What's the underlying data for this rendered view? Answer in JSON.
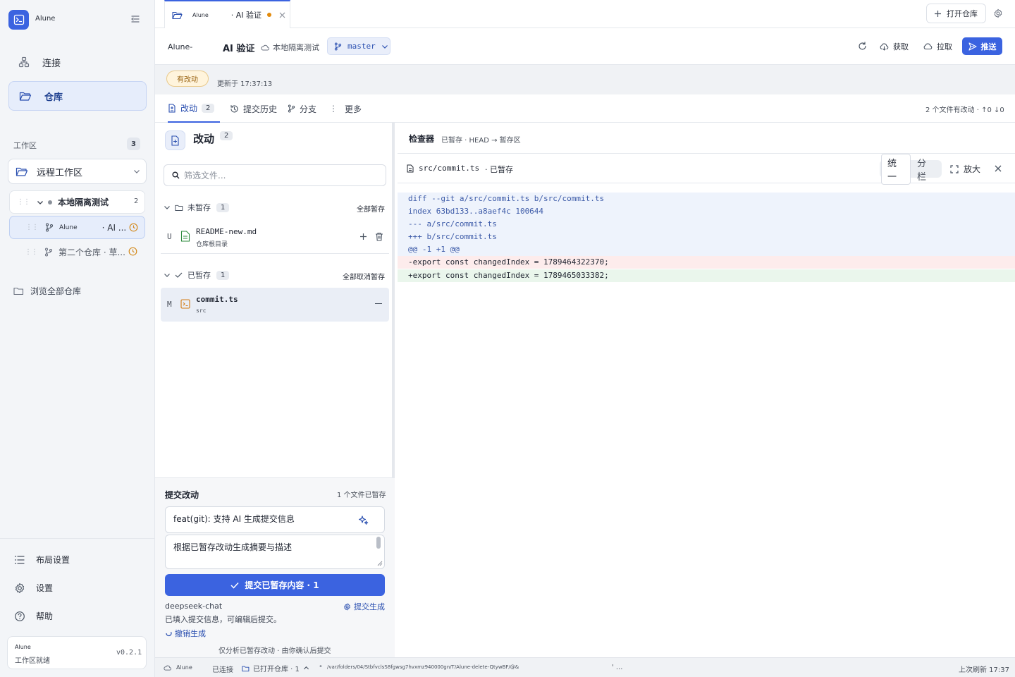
{
  "app": {
    "name": "Alune"
  },
  "sidebar": {
    "nav": [
      {
        "label": "连接",
        "icon": "network-icon"
      },
      {
        "label": "仓库",
        "icon": "folder-open-icon"
      }
    ],
    "workspace_label": "工作区",
    "workspace_count": "3",
    "workspace_select": "远程工作区",
    "tree": {
      "group": "本地隔离测试",
      "group_count": "2",
      "items": [
        {
          "name": "Alune",
          "suffix": "· AI ..."
        },
        {
          "name": "第二个仓库 · 草..."
        }
      ]
    },
    "browse_all": "浏览全部仓库",
    "bottom": [
      {
        "label": "布局设置",
        "icon": "layout-list-icon"
      },
      {
        "label": "设置",
        "icon": "gear-icon"
      },
      {
        "label": "帮助",
        "icon": "help-icon"
      }
    ],
    "status_card": {
      "title": "Alune",
      "subtitle": "工作区就绪",
      "version": "v0.2.1"
    }
  },
  "topbar": {
    "tab": {
      "name": "Alune",
      "title": "· AI 验证"
    },
    "open_repo": "打开仓库"
  },
  "repo_header": {
    "repo_name": "Alune-",
    "title": "AI 验证",
    "workspace": "本地隔离测试",
    "branch": "master",
    "fetch": "获取",
    "pull": "拉取",
    "push": "推送"
  },
  "strip": {
    "badge": "有改动",
    "updated": "更新于 17:37:13"
  },
  "subtabs": {
    "items": [
      {
        "label": "改动",
        "count": "2"
      },
      {
        "label": "提交历史"
      },
      {
        "label": "分支"
      },
      {
        "label": "更多"
      }
    ],
    "summary": "2 个文件有改动 · ↑0 ↓0"
  },
  "changes": {
    "title": "改动",
    "count": "2",
    "filter_placeholder": "筛选文件...",
    "unstaged": {
      "label": "未暂存",
      "count": "1",
      "action": "全部暂存",
      "files": [
        {
          "status": "U",
          "name": "README-new.md",
          "dir": "仓库根目录"
        }
      ]
    },
    "staged": {
      "label": "已暂存",
      "count": "1",
      "action": "全部取消暂存",
      "files": [
        {
          "status": "M",
          "name": "commit.ts",
          "dir": "src"
        }
      ]
    }
  },
  "commit": {
    "title": "提交改动",
    "staged_info": "1 个文件已暂存",
    "message": "feat(git): 支持 AI 生成提交信息",
    "description": "根据已暂存改动生成摘要与描述",
    "button": "提交已暂存内容 · 1",
    "model": "deepseek-chat",
    "gen_link": "提交生成",
    "filled_note": "已填入提交信息，可编辑后提交。",
    "undo": "撤销生成",
    "footer": "仅分析已暂存改动 · 由你确认后提交"
  },
  "inspector": {
    "title": "检查器",
    "subtitle": "已暂存 · HEAD → 暂存区",
    "file": "src/commit.ts",
    "file_state": "· 已暂存",
    "view_unified": "统一",
    "view_split": "分栏",
    "zoom": "放大",
    "diff": [
      {
        "kind": "meta",
        "text": "diff --git a/src/commit.ts b/src/commit.ts"
      },
      {
        "kind": "meta",
        "text": "index 63bd133..a8aef4c 100644"
      },
      {
        "kind": "meta",
        "text": "--- a/src/commit.ts"
      },
      {
        "kind": "meta",
        "text": "+++ b/src/commit.ts"
      },
      {
        "kind": "meta",
        "text": "@@ -1 +1 @@"
      },
      {
        "kind": "del",
        "text": "-export const changedIndex = 1789464322370;"
      },
      {
        "kind": "add",
        "text": "+export const changedIndex = 1789465033382;"
      }
    ]
  },
  "statusbar": {
    "app": "Alune",
    "connected": "已连接",
    "open_repos": "已打开仓库 · 1",
    "path": "/var/folders/04/StbfvclsS8fgwsg7hvxmz940000gn/T/Alune-delete-QtywBF/@&",
    "ellipsis": "' ...",
    "refreshed": "上次刷新 17:37"
  },
  "colors": {
    "accent": "#3b63e0",
    "dirty": "#e28a0c",
    "del_bg": "#fdecec",
    "add_bg": "#eaf6ec",
    "meta_bg": "#eef3fc"
  }
}
